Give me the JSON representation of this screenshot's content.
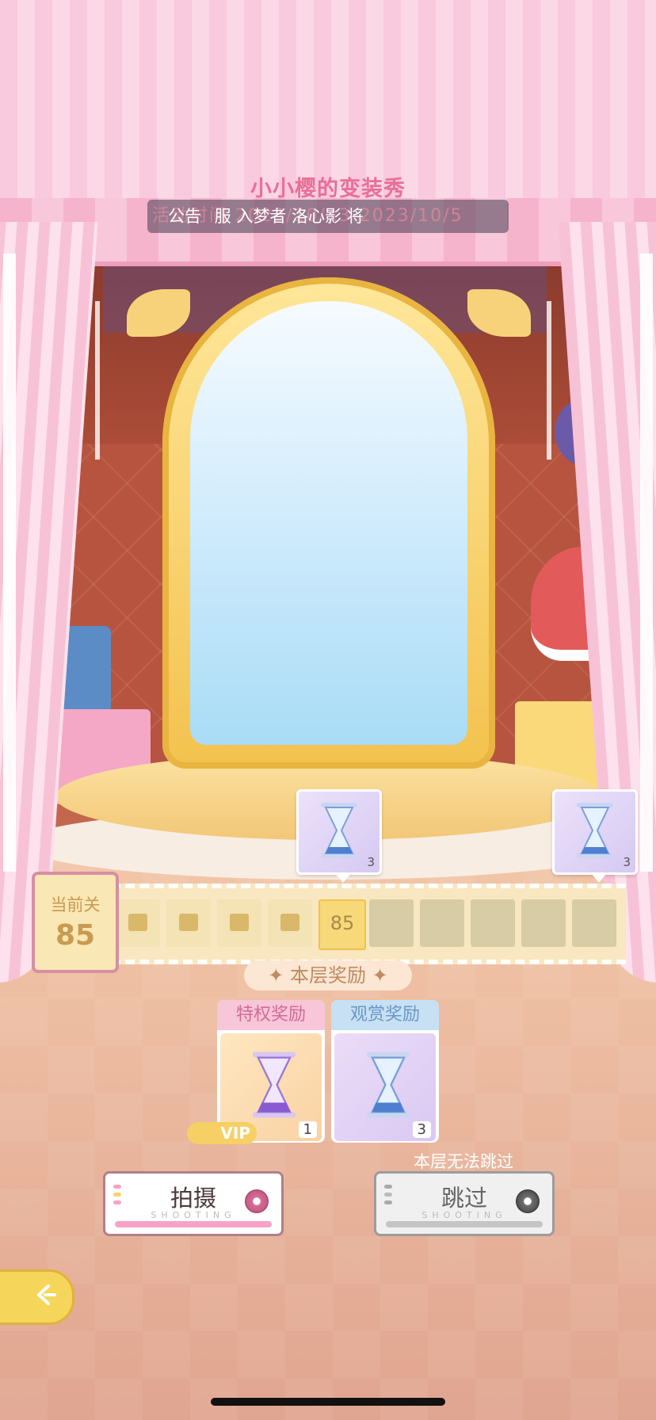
{
  "header": {
    "title": "小小樱的变装秀",
    "notice_label": "公告",
    "notice_text": "服 入梦者 洛心影 将",
    "notice_background_text": "活动时间 2023/10/13-2023/10/5"
  },
  "preview_rewards": [
    {
      "icon": "hourglass-icon",
      "quantity": "3"
    },
    {
      "icon": "hourglass-icon",
      "quantity": "3"
    }
  ],
  "level": {
    "label": "当前关",
    "current": "85",
    "slots": [
      "done",
      "done",
      "done",
      "done",
      "current",
      "empty",
      "empty",
      "empty",
      "empty",
      "empty"
    ],
    "current_slot_text": "85"
  },
  "floor_rewards": {
    "title": "本层奖励",
    "privilege": {
      "label": "特权奖励",
      "quantity": "1",
      "badge": "VIP",
      "icon": "hourglass-icon"
    },
    "watch": {
      "label": "观赏奖励",
      "quantity": "3",
      "icon": "hourglass-icon"
    }
  },
  "actions": {
    "skip_hint": "本层无法跳过",
    "shoot_label": "拍摄",
    "shoot_sub": "SHOOTING",
    "skip_label": "跳过",
    "skip_sub": "SHOOTING"
  },
  "colors": {
    "accent_pink": "#e96f97",
    "gold": "#f6d65a",
    "curtain_pink": "#f8c2d6"
  }
}
